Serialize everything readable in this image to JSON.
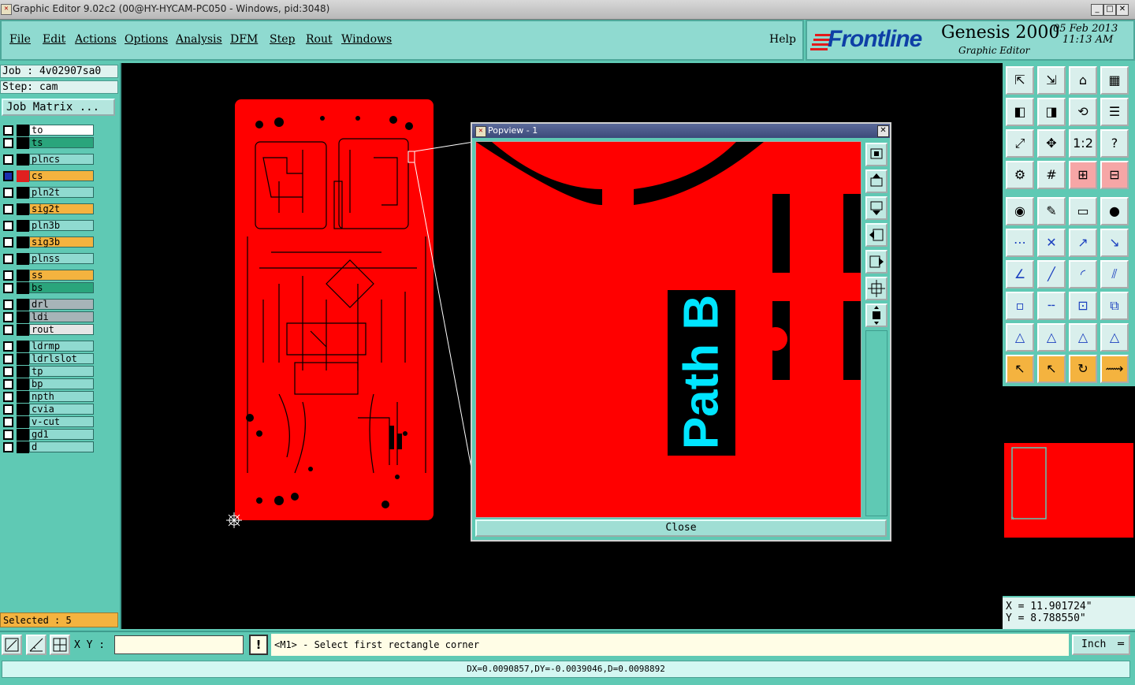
{
  "window": {
    "title": "Graphic Editor 9.02c2 (00@HY-HYCAM-PC050 - Windows, pid:3048)"
  },
  "menu": {
    "file": "File",
    "edit": "Edit",
    "actions": "Actions",
    "options": "Options",
    "analysis": "Analysis",
    "dfm": "DFM",
    "step": "Step",
    "rout": "Rout",
    "windows": "Windows",
    "help": "Help"
  },
  "brand": {
    "logo": "Frontline",
    "product": "Genesis 2000",
    "subtitle": "Graphic Editor",
    "date": "05 Feb 2013",
    "time": "11:13 AM"
  },
  "job": {
    "job_line": "Job : 4v02907sa0",
    "step_line": "Step: cam",
    "matrix_button": "Job Matrix ..."
  },
  "layers": [
    {
      "name": "to",
      "color": "#ffffff"
    },
    {
      "name": "ts",
      "color": "#2aa57c"
    },
    {
      "name": "plncs",
      "color": "#8fdad0"
    },
    {
      "name": "cs",
      "color": "#f4b33f"
    },
    {
      "name": "pln2t",
      "color": "#8fdad0"
    },
    {
      "name": "sig2t",
      "color": "#f4b33f"
    },
    {
      "name": "pln3b",
      "color": "#8fdad0"
    },
    {
      "name": "sig3b",
      "color": "#f4b33f"
    },
    {
      "name": "plnss",
      "color": "#8fdad0"
    },
    {
      "name": "ss",
      "color": "#f4b33f"
    },
    {
      "name": "bs",
      "color": "#2aa57c"
    },
    {
      "name": "drl",
      "color": "#a7b4b8"
    },
    {
      "name": "ldi",
      "color": "#a7b4b8"
    },
    {
      "name": "rout",
      "color": "#e6e6e6"
    },
    {
      "name": "ldrmp",
      "color": "#8fdad0"
    },
    {
      "name": "ldrlslot",
      "color": "#8fdad0"
    },
    {
      "name": "tp",
      "color": "#8fdad0"
    },
    {
      "name": "bp",
      "color": "#8fdad0"
    },
    {
      "name": "npth",
      "color": "#8fdad0"
    },
    {
      "name": "cvia",
      "color": "#8fdad0"
    },
    {
      "name": "v-cut",
      "color": "#8fdad0"
    },
    {
      "name": "gd1",
      "color": "#8fdad0"
    },
    {
      "name": "d",
      "color": "#8fdad0"
    }
  ],
  "selection": {
    "label": "Selected : 5"
  },
  "popview": {
    "title": "Popview - 1",
    "feature_text": "Path B",
    "close_label": "Close"
  },
  "cursor": {
    "x_line": "X = 11.901724\"",
    "y_line": "Y = 8.788550\""
  },
  "bottom": {
    "xy_label": "X Y :",
    "xy_value": "",
    "warn": "!",
    "prompt": "<M1> - Select first rectangle corner",
    "unit": "Inch",
    "measure": "DX=0.0090857,DY=-0.0039046,D=0.0098892"
  },
  "colors": {
    "teal_bg": "#5fc9b4",
    "board_red": "#ff0000",
    "feature_cyan": "#00e5ff",
    "active_orange": "#f4b33f"
  }
}
